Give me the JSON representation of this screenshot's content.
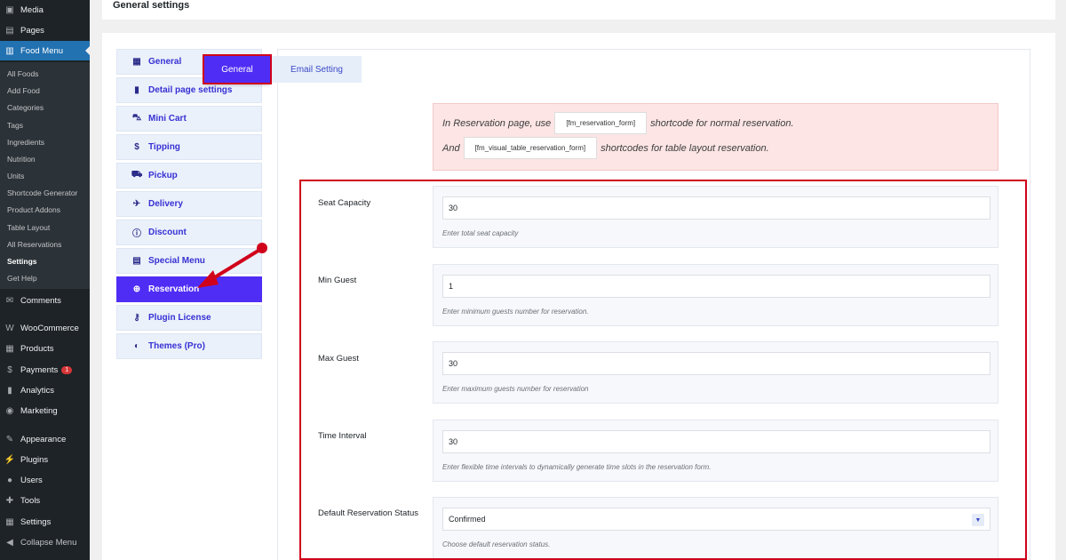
{
  "wp_menu": {
    "top": [
      {
        "icon": "media-icon",
        "glyph": "▣",
        "label": "Media"
      },
      {
        "icon": "pages-icon",
        "glyph": "▤",
        "label": "Pages"
      },
      {
        "icon": "food-menu-icon",
        "glyph": "▥",
        "label": "Food Menu"
      }
    ],
    "submenu": [
      "All Foods",
      "Add Food",
      "Categories",
      "Tags",
      "Ingredients",
      "Nutrition",
      "Units",
      "Shortcode Generator",
      "Product Addons",
      "Table Layout",
      "All Reservations",
      "Settings",
      "Get Help"
    ],
    "current_submenu": "Settings",
    "bottom": [
      {
        "icon": "comments-icon",
        "glyph": "✉",
        "label": "Comments"
      },
      {
        "icon": "woocommerce-icon",
        "glyph": "W",
        "label": "WooCommerce"
      },
      {
        "icon": "products-icon",
        "glyph": "▦",
        "label": "Products"
      },
      {
        "icon": "payments-icon",
        "glyph": "$",
        "label": "Payments",
        "badge": "1"
      },
      {
        "icon": "analytics-icon",
        "glyph": "▮",
        "label": "Analytics"
      },
      {
        "icon": "marketing-icon",
        "glyph": "◉",
        "label": "Marketing"
      },
      {
        "icon": "appearance-icon",
        "glyph": "✎",
        "label": "Appearance"
      },
      {
        "icon": "plugins-icon",
        "glyph": "⚡",
        "label": "Plugins"
      },
      {
        "icon": "users-icon",
        "glyph": "●",
        "label": "Users"
      },
      {
        "icon": "tools-icon",
        "glyph": "✚",
        "label": "Tools"
      },
      {
        "icon": "settings-icon",
        "glyph": "▦",
        "label": "Settings"
      },
      {
        "icon": "collapse-icon",
        "glyph": "◀",
        "label": "Collapse Menu"
      }
    ]
  },
  "page_title": "General settings",
  "settings_nav": [
    {
      "icon": "general-icon",
      "glyph": "▦",
      "label": "General"
    },
    {
      "icon": "detail-page-icon",
      "glyph": "▮",
      "label": "Detail page settings"
    },
    {
      "icon": "cart-icon",
      "glyph": "🛒",
      "label": "Mini Cart"
    },
    {
      "icon": "dollar-icon",
      "glyph": "$",
      "label": "Tipping"
    },
    {
      "icon": "car-icon",
      "glyph": "⛟",
      "label": "Pickup"
    },
    {
      "icon": "plane-icon",
      "glyph": "✈",
      "label": "Delivery"
    },
    {
      "icon": "info-icon",
      "glyph": "ⓘ",
      "label": "Discount"
    },
    {
      "icon": "table-icon",
      "glyph": "▤",
      "label": "Special Menu"
    },
    {
      "icon": "plus-circle-icon",
      "glyph": "⊕",
      "label": "Reservation"
    },
    {
      "icon": "key-icon",
      "glyph": "⚷",
      "label": "Plugin License"
    },
    {
      "icon": "palette-icon",
      "glyph": "◐",
      "label": "Themes (Pro)"
    }
  ],
  "active_nav": "Reservation",
  "tabs": {
    "general": "General",
    "email": "Email Setting"
  },
  "info": {
    "line1_pre": "In Reservation page, use",
    "line1_code": "[fm_reservation_form]",
    "line1_post": "shortcode for normal reservation.",
    "line2_pre": "And",
    "line2_code": "[fm_visual_table_reservation_form]",
    "line2_post": "shortcodes for table layout reservation."
  },
  "fields": {
    "seat_capacity": {
      "label": "Seat Capacity",
      "value": "30",
      "hint": "Enter total seat capacity"
    },
    "min_guest": {
      "label": "Min Guest",
      "value": "1",
      "hint": "Enter minimum guests number for reservation."
    },
    "max_guest": {
      "label": "Max Guest",
      "value": "30",
      "hint": "Enter maximum guests number for reservation"
    },
    "time_interval": {
      "label": "Time Interval",
      "value": "30",
      "hint": "Enter flexible time intervals to dynamically generate time slots in the reservation form."
    },
    "default_status": {
      "label": "Default Reservation Status",
      "value": "Confirmed",
      "hint": "Choose default reservation status."
    }
  },
  "colors": {
    "accent": "#4f2df5",
    "highlight": "#d0021b",
    "wp_active": "#2271b1"
  }
}
